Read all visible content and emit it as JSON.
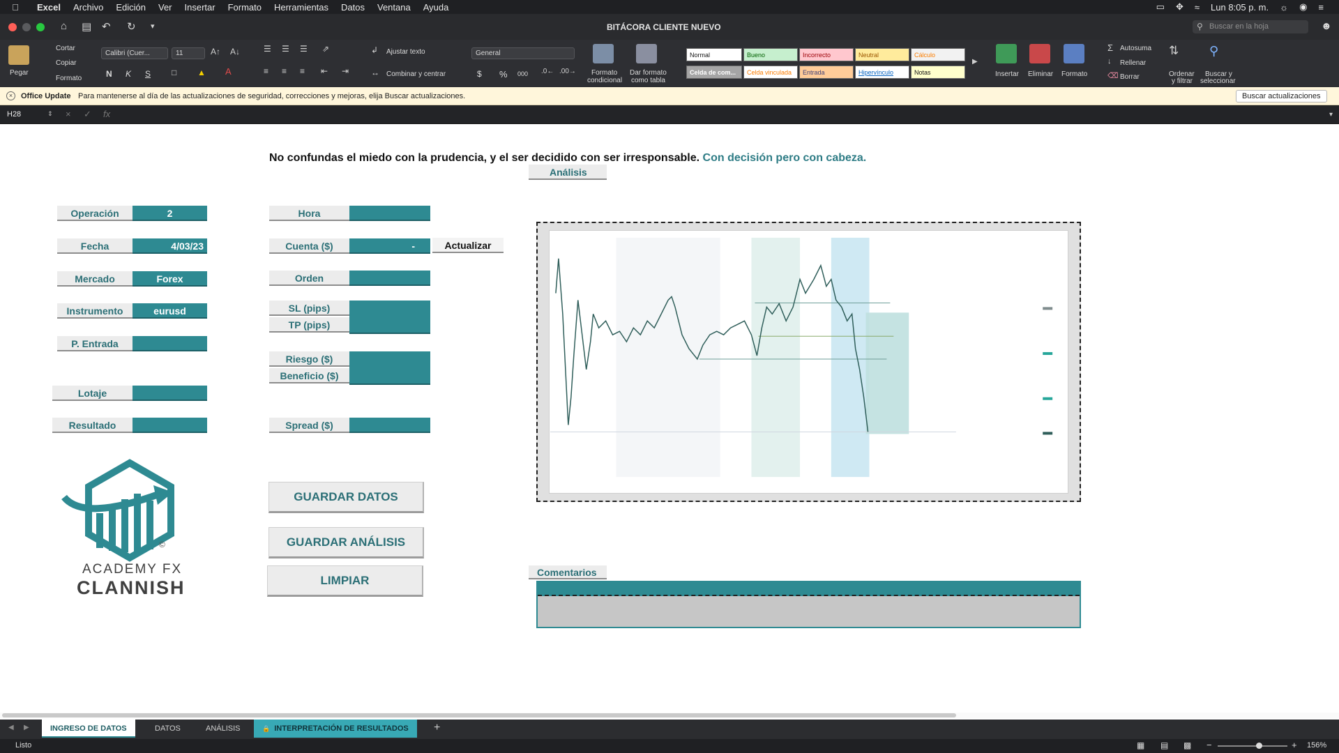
{
  "menubar": {
    "app": "Excel",
    "items": [
      "Archivo",
      "Edición",
      "Ver",
      "Insertar",
      "Formato",
      "Herramientas",
      "Datos",
      "Ventana",
      "Ayuda"
    ],
    "clock": "Lun 8:05 p. m."
  },
  "window": {
    "title": "BITÁCORA CLIENTE NUEVO",
    "search_placeholder": "Buscar en la hoja"
  },
  "ribbon": {
    "paste": "Pegar",
    "cut": "Cortar",
    "copy": "Copiar",
    "format_painter": "Formato",
    "font_name": "Calibri (Cuer...",
    "font_size": "11",
    "bold": "N",
    "italic": "K",
    "strike": "S",
    "wrap_text": "Ajustar texto",
    "merge_center": "Combinar y centrar",
    "number_format": "General",
    "currency": "$",
    "percent": "%",
    "thousands": "000",
    "cond_format_1": "Formato",
    "cond_format_2": "condicional",
    "table_format_1": "Dar formato",
    "table_format_2": "como tabla",
    "styles": {
      "normal": "Normal",
      "bueno": "Bueno",
      "incorrecto": "Incorrecto",
      "neutral": "Neutral",
      "calculo": "Cálculo",
      "celda_com": "Celda de com...",
      "celda_vinculada": "Celda vinculada",
      "entrada": "Entrada",
      "hipervinculo": "Hipervínculo",
      "notas": "Notas"
    },
    "insert": "Insertar",
    "delete": "Eliminar",
    "format": "Formato",
    "autosum": "Autosuma",
    "fill": "Rellenar",
    "clear": "Borrar",
    "sort_1": "Ordenar",
    "sort_2": "y filtrar",
    "find_1": "Buscar y",
    "find_2": "seleccionar"
  },
  "update_bar": {
    "title": "Office Update",
    "message": "Para mantenerse al día de las actualizaciones de seguridad, correcciones y mejoras, elija Buscar actualizaciones.",
    "button": "Buscar actualizaciones"
  },
  "formula_bar": {
    "cell_ref": "H28",
    "fx": "fx"
  },
  "sheet": {
    "quote_main": "No confundas el miedo con la prudencia, y el ser decidido con ser irresponsable.",
    "quote_highlight": "Con decisión pero con cabeza.",
    "fields_left": [
      {
        "label": "Operación",
        "value": "2"
      },
      {
        "label": "Fecha",
        "value": "4/03/23"
      },
      {
        "label": "Mercado",
        "value": "Forex"
      },
      {
        "label": "Instrumento",
        "value": "eurusd"
      },
      {
        "label": "P. Entrada",
        "value": ""
      },
      {
        "label": "Lotaje",
        "value": ""
      },
      {
        "label": "Resultado",
        "value": ""
      }
    ],
    "fields_mid": {
      "hora": "Hora",
      "cuenta": "Cuenta ($)",
      "cuenta_value": "-",
      "actualizar": "Actualizar",
      "orden": "Orden",
      "sl": "SL (pips)",
      "tp": "TP (pips)",
      "riesgo": "Riesgo ($)",
      "beneficio": "Beneficio ($)",
      "spread": "Spread ($)"
    },
    "buttons": {
      "save_data": "GUARDAR DATOS",
      "save_analysis": "GUARDAR ANÁLISIS",
      "clear": "LIMPIAR"
    },
    "logo": {
      "line1": "ACADEMY FX",
      "line2": "CLANNISH",
      "mark": "©"
    },
    "analysis_label": "Análisis",
    "comments_label": "Comentarios"
  },
  "tabs": [
    {
      "label": "INGRESO DE DATOS",
      "state": "active"
    },
    {
      "label": "DATOS",
      "state": "normal"
    },
    {
      "label": "ANÁLISIS",
      "state": "normal"
    },
    {
      "label": "INTERPRETACIÓN DE RESULTADOS",
      "state": "locked"
    }
  ],
  "tabs_add": "+",
  "status": {
    "ready": "Listo",
    "zoom": "156%"
  },
  "colors": {
    "teal": "#2e8a92",
    "teal_text": "#2b6f76",
    "chart_up": "#26a69a",
    "chart_line": "#2f5e5a"
  }
}
